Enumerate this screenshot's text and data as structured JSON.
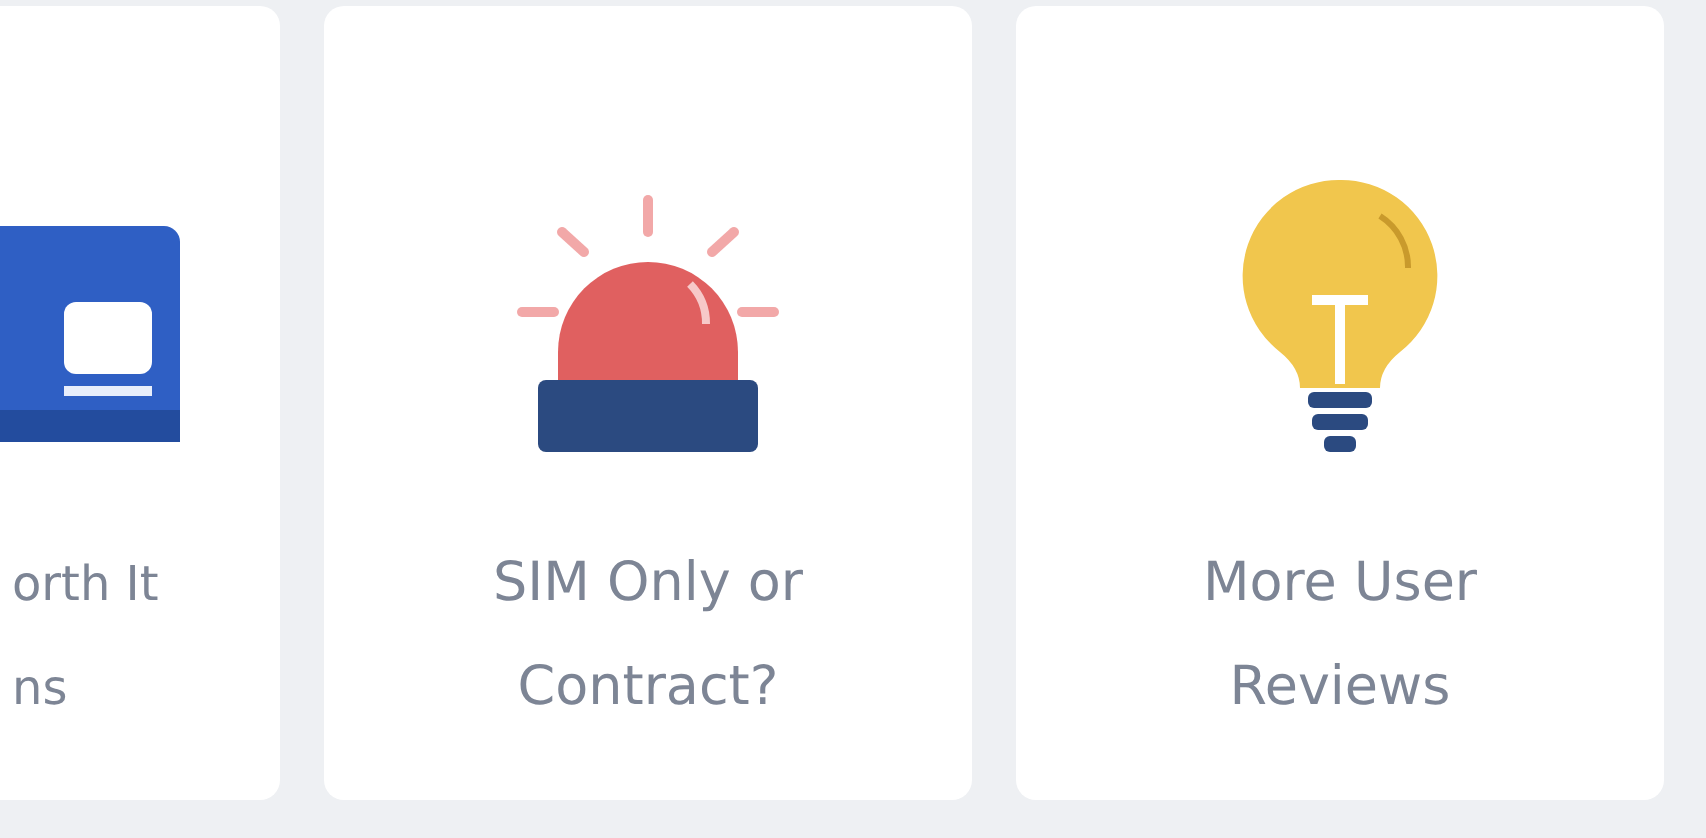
{
  "cards": [
    {
      "kind": "card",
      "lines": [
        "orth It",
        "ns"
      ]
    },
    {
      "kind": "siren",
      "lines": [
        "SIM Only or",
        "Contract?"
      ]
    },
    {
      "kind": "bulb",
      "lines": [
        "More User",
        "Reviews"
      ]
    }
  ]
}
